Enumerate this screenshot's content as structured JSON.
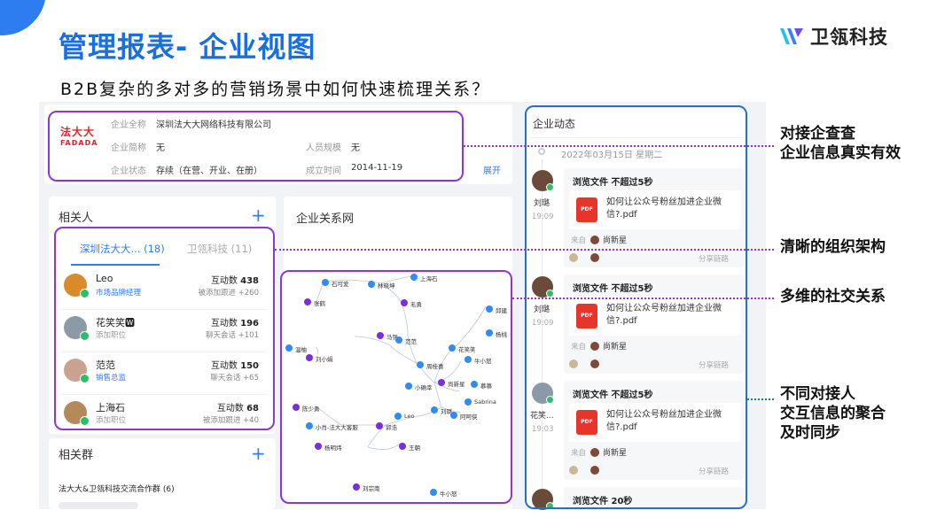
{
  "slide": {
    "title": "管理报表- 企业视图",
    "subtitle": "B2B复杂的多对多的营销场景中如何快速梳理关系？",
    "brand": "卫瓴科技"
  },
  "colors": {
    "accent": "#2f7cf6",
    "highlight": "#8b37d9",
    "title": "#1a6fe0"
  },
  "company": {
    "logo_top": "法大大",
    "logo_bottom": "FADADA",
    "full_name_label": "企业全称",
    "full_name": "深圳法大大网络科技有限公司",
    "short_name_label": "企业简称",
    "short_name": "无",
    "staff_label": "人员规模",
    "staff": "无",
    "status_label": "企业状态",
    "status": "存续（在营、开业、在册）",
    "founded_label": "成立时间",
    "founded": "2014-11-19",
    "expand": "展开"
  },
  "contacts": {
    "title": "相关人",
    "tabs": [
      {
        "label": "深圳法大大... (18)"
      },
      {
        "label": "卫瓴科技 (11)"
      }
    ],
    "items": [
      {
        "name": "Leo",
        "role": "市场品牌经理",
        "role_color": "#2f7cf6",
        "count_label": "互动数",
        "count": "438",
        "sub": "被添加跟进 +260",
        "avatar_color": "#d98a2b"
      },
      {
        "name": "花笑笑🆆",
        "role": "添加职位",
        "role_color": "#999999",
        "count_label": "互动数",
        "count": "196",
        "sub": "聊天会话 +101",
        "avatar_color": "#8a9aa8"
      },
      {
        "name": "范范",
        "role": "销售总监",
        "role_color": "#2f7cf6",
        "count_label": "互动数",
        "count": "150",
        "sub": "聊天会话 +65",
        "avatar_color": "#c9a38f"
      },
      {
        "name": "上海石",
        "role": "添加职位",
        "role_color": "#999999",
        "count_label": "互动数",
        "count": "68",
        "sub": "被添加跟进 +40",
        "avatar_color": "#b58a5a"
      }
    ]
  },
  "groups": {
    "title": "相关群",
    "items": [
      "法大大&卫瓴科技交流合作群 (6)"
    ]
  },
  "relation": {
    "title": "企业关系网",
    "nodes": [
      {
        "label": "石可爱",
        "color": "#2f8cf6"
      },
      {
        "label": "林晓坤",
        "color": "#2f8cf6"
      },
      {
        "label": "上海石",
        "color": "#2f8cf6"
      },
      {
        "label": "张鹤",
        "color": "#7b2de0"
      },
      {
        "label": "毛勇",
        "color": "#7b2de0"
      },
      {
        "label": "邱建",
        "color": "#2f8cf6"
      },
      {
        "label": "杨桃",
        "color": "#2f8cf6"
      },
      {
        "label": "温柚",
        "color": "#2f8cf6"
      },
      {
        "label": "马强",
        "color": "#7b2de0"
      },
      {
        "label": "范范",
        "color": "#2f8cf6"
      },
      {
        "label": "花笑笑",
        "color": "#2f8cf6"
      },
      {
        "label": "刘小娟",
        "color": "#7b2de0"
      },
      {
        "label": "牛小怒",
        "color": "#2f8cf6"
      },
      {
        "label": "周桂喜",
        "color": "#2f8cf6"
      },
      {
        "label": "慕慕",
        "color": "#2f8cf6"
      },
      {
        "label": "小确幸",
        "color": "#2f8cf6"
      },
      {
        "label": "尚新星",
        "color": "#7b2de0"
      },
      {
        "label": "Sabrina",
        "color": "#2f8cf6"
      },
      {
        "label": "陈少勇",
        "color": "#7b2de0"
      },
      {
        "label": "刘璐",
        "color": "#2f8cf6"
      },
      {
        "label": "阿呵侠",
        "color": "#2f8cf6"
      },
      {
        "label": "Leo",
        "color": "#2f8cf6"
      },
      {
        "label": "小肖-法大大客服",
        "color": "#2f8cf6"
      },
      {
        "label": "郭浩",
        "color": "#7b2de0"
      },
      {
        "label": "杨明炜",
        "color": "#7b2de0"
      },
      {
        "label": "王朝",
        "color": "#7b2de0"
      },
      {
        "label": "刘宗南",
        "color": "#7b2de0"
      },
      {
        "label": "牛小怒",
        "color": "#2f8cf6"
      }
    ]
  },
  "activity": {
    "title": "企业动态",
    "date": "2022年03月15日 星期二",
    "items": [
      {
        "user": "刘璐",
        "time": "19:09",
        "head": "浏览文件 不超过5秒",
        "file": "如何让公众号粉丝加进企业微信?.pdf",
        "from_label": "来自",
        "from": "尚新星",
        "share": "分享链路",
        "avatar_color": "#6b4a3a"
      },
      {
        "user": "刘璐",
        "time": "19:09",
        "head": "浏览文件 不超过5秒",
        "file": "如何让公众号粉丝加进企业微信?.pdf",
        "from_label": "来自",
        "from": "尚新星",
        "share": "分享链路",
        "avatar_color": "#6b4a3a"
      },
      {
        "user": "花笑...",
        "time": "19:03",
        "head": "浏览文件 不超过5秒",
        "file": "如何让公众号粉丝加进企业微信?.pdf",
        "from_label": "来自",
        "from": "尚新星",
        "share": "分享链路",
        "avatar_color": "#8a9aa8"
      },
      {
        "user": "",
        "time": "",
        "head": "浏览文件 20秒",
        "file": "",
        "from_label": "",
        "from": "",
        "share": "",
        "avatar_color": "#6b4a3a"
      }
    ],
    "pdf_tag": "PDF"
  },
  "annotations": {
    "a1_l1": "对接企查查",
    "a1_l2": "企业信息真实有效",
    "a2": "清晰的组织架构",
    "a3": "多维的社交关系",
    "a4_l1": "不同对接人",
    "a4_l2": "交互信息的聚合",
    "a4_l3": "及时同步"
  }
}
